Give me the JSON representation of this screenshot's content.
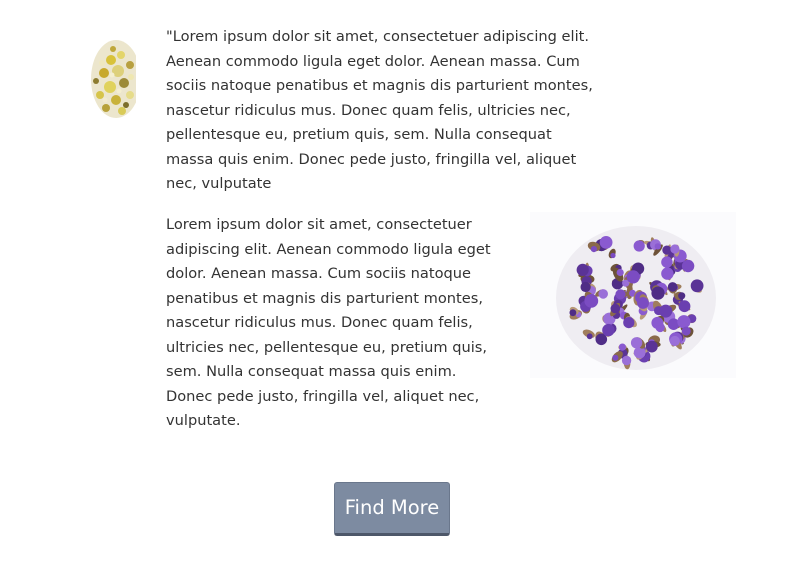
{
  "content": {
    "paragraph_1": "\"Lorem ipsum dolor sit amet, consectetuer adipiscing elit. Aenean commodo ligula eget dolor. Aenean massa. Cum sociis natoque penatibus et magnis dis parturient montes, nascetur ridiculus mus. Donec quam felis, ultricies nec, pellentesque eu, pretium quis, sem. Nulla consequat massa quis enim. Donec pede justo, fringilla vel, aliquet nec, vulputate",
    "paragraph_2": "Lorem ipsum dolor sit amet, consectetuer adipiscing elit. Aenean commodo ligula eget dolor. Aenean massa. Cum sociis natoque penatibus et magnis dis parturient montes, nascetur ridiculus mus. Donec quam felis, ultricies nec, pellentesque eu, pretium quis, sem. Nulla consequat massa quis enim. Donec pede justo, fringilla vel, aliquet nec, vulputate."
  },
  "images": {
    "left_image": "chamomile-flowers-image",
    "right_image": "dried-purple-statice-flowers-image"
  },
  "cta": {
    "find_more_label": "Find More"
  },
  "colors": {
    "button_bg": "#7d8ba1",
    "button_text": "#ffffff",
    "body_text": "#333333",
    "chamomile_yellow": "#d8c23a",
    "statice_purple": "#6a3fb0"
  }
}
